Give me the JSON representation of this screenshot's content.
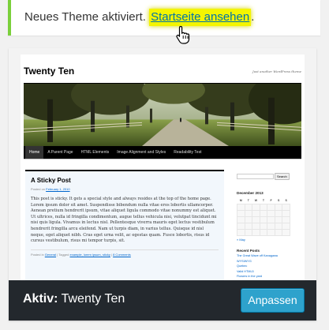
{
  "notice": {
    "text": "Neues Theme aktiviert. ",
    "link": "Startseite ansehen",
    "after": ".",
    "colors": {
      "border": "#7ad03a",
      "highlight": "#f4f500",
      "link": "#0073aa"
    }
  },
  "preview": {
    "site_title": "Twenty Ten",
    "site_description": "Just another WordPress theme",
    "menu": [
      "Home",
      "A Parent Page",
      "HTML Elements",
      "Image Alignment and Styles",
      "Readability Test"
    ],
    "post": {
      "title": "A Sticky Post",
      "meta_prefix": "Posted on ",
      "date": "February 1, 2010",
      "body": "This post is sticky. It gets a special style and always resides at the top of the home page. Lorem ipsum dolor sit amet. Suspendisse bibendum nulla vitae eros lobortis ullamcorper. Aenean pretium hendrerit ipsum, vitae aliquet ligula commodo vitae nonummy est aliquet. Ut ultrices, nulla id fringilla condimentum, augue tellus vehicula nisi, volutpat tincidunt mi nisi quis ligula. Vivamus in lectus nisl. Pellentesque viverra mauris eget lectus vestibulum hendrerit fringilla arcu eleifend. Nam ut turpis diam, in varius tellus. Quisque id nisl neque, eget aliquet nibh. Cras eget urna velit, ac egestas quam. Fusce lobortis, risus id cursus vestibulum, risus mi tempor turpis, sit.",
      "footer_prefix": "Posted in ",
      "category": "General",
      "tagged": " | Tagged ",
      "tags": "example, lorem ipsum, sticky",
      "comments": "8 Comments"
    },
    "sidebar": {
      "search_button": "Search",
      "calendar_caption": "December 2013",
      "weekdays": [
        "M",
        "T",
        "W",
        "T",
        "F",
        "S",
        "S"
      ],
      "calendar_nav": "« May",
      "recent_heading": "Recent Posts",
      "recent_posts": [
        "The Great Wave off Kanagawa",
        "WYSIWYG",
        "Quebec",
        "Valid HTML5",
        "Flowers in the yard"
      ]
    }
  },
  "theme_bar": {
    "active_label": "Aktiv:",
    "theme_name": " Twenty Ten",
    "customize_label": "Anpassen",
    "colors": {
      "bar": "#23282d",
      "button": "#2ea2cc"
    }
  }
}
